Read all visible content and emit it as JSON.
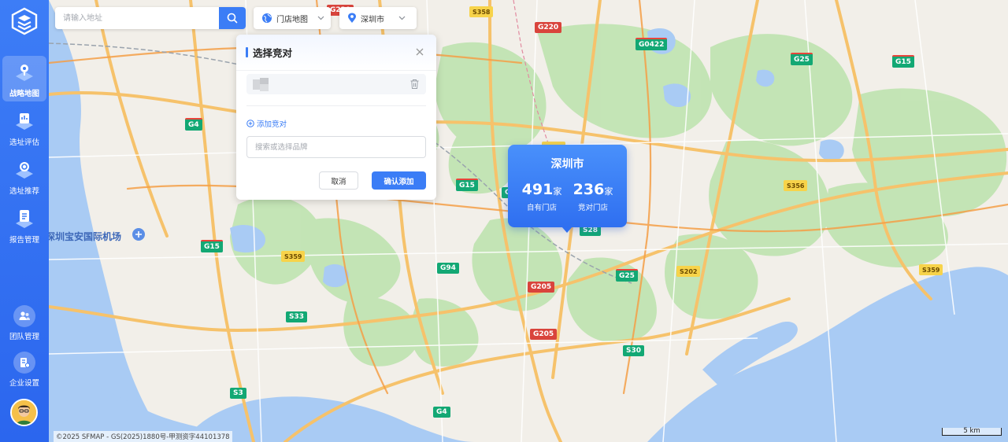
{
  "sidebar": {
    "logo_icon": "app-logo-icon",
    "items": [
      {
        "label": "战略地图",
        "icon": "strategy-map-icon",
        "active": true
      },
      {
        "label": "选址评估",
        "icon": "site-evaluation-icon",
        "active": false
      },
      {
        "label": "选址推荐",
        "icon": "site-recommend-icon",
        "active": false
      },
      {
        "label": "报告管理",
        "icon": "report-icon",
        "active": false
      }
    ],
    "bottom": [
      {
        "label": "团队管理",
        "icon": "team-icon"
      },
      {
        "label": "企业设置",
        "icon": "enterprise-settings-icon"
      }
    ]
  },
  "search": {
    "placeholder": "请输入地址"
  },
  "dropdowns": {
    "map_type": "门店地图",
    "city": "深圳市"
  },
  "panel": {
    "title": "选择竞对",
    "add_link": "添加竞对",
    "input_placeholder": "搜索或选择品牌",
    "cancel": "取消",
    "confirm": "确认添加"
  },
  "city_popup": {
    "name": "深圳市",
    "own_count": "491",
    "own_unit": "家",
    "own_label": "自有门店",
    "comp_count": "236",
    "comp_unit": "家",
    "comp_label": "竞对门店"
  },
  "map": {
    "airport_label": "深圳宝安国际机场",
    "copyright": "©2025 SFMAP - GS(2025)1880号-甲测资字44101378",
    "scale": "5 km",
    "shields": [
      "G220",
      "G0422",
      "G25",
      "G15",
      "G4",
      "G15",
      "S358",
      "G220",
      "S359",
      "G15",
      "S356",
      "G15",
      "S359",
      "S33",
      "G94",
      "G205",
      "S28",
      "G25",
      "S202",
      "S359",
      "G205",
      "S30",
      "S3",
      "G4"
    ]
  },
  "colors": {
    "accent": "#3b7df6",
    "sidebar": "#2b66ee",
    "water": "#a9cbf4",
    "green": "#bfe3b0"
  }
}
